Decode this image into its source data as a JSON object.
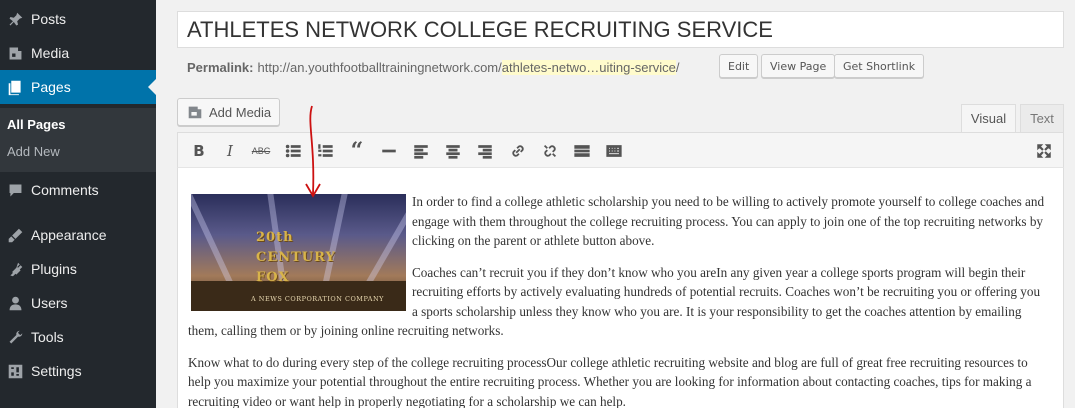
{
  "sidebar": {
    "items": [
      {
        "label": "Posts",
        "icon": "pin-icon"
      },
      {
        "label": "Media",
        "icon": "media-icon"
      },
      {
        "label": "Pages",
        "icon": "pages-icon"
      },
      {
        "label": "Comments",
        "icon": "comments-icon"
      },
      {
        "label": "Appearance",
        "icon": "appearance-icon"
      },
      {
        "label": "Plugins",
        "icon": "plugins-icon"
      },
      {
        "label": "Users",
        "icon": "users-icon"
      },
      {
        "label": "Tools",
        "icon": "tools-icon"
      },
      {
        "label": "Settings",
        "icon": "settings-icon"
      }
    ],
    "submenu": [
      "All Pages",
      "Add New"
    ]
  },
  "editor": {
    "title": "ATHLETES NETWORK COLLEGE RECRUITING SERVICE",
    "permalink_label": "Permalink:",
    "permalink_base": "http://an.youthfootballtrainingnetwork.com/",
    "permalink_slug": "athletes-netwo…uiting-service",
    "permalink_tail": "/",
    "edit_label": "Edit",
    "view_label": "View Page",
    "shortlink_label": "Get Shortlink",
    "add_media_label": "Add Media",
    "tab_visual": "Visual",
    "tab_text": "Text",
    "image_text": "20th CENTURY FOX",
    "image_subtext": "A NEWS CORPORATION COMPANY",
    "paragraphs": [
      "In order to find a college athletic scholarship you need to be willing to actively promote yourself to college coaches and engage with them throughout the college recruiting process. You can apply to join one of the top recruiting networks by clicking on the parent or athlete button above.",
      "Coaches can’t recruit you if they don’t know who you areIn any given year a college sports program will begin their recruiting efforts by actively evaluating hundreds of potential recruits. Coaches won’t be recruiting you or offering you a sports scholarship unless they know who you are. It is your responsibility to get the coaches attention by emailing them, calling them or by joining online recruiting networks.",
      "Know what to do during every step of the college recruiting processOur college athletic recruiting website and blog are full of great free recruiting resources to help you maximize your potential throughout the entire recruiting process. Whether you are looking for information about contacting coaches, tips for making a recruiting video or want help in properly negotiating for a scholarship we can help."
    ]
  },
  "colors": {
    "sidebar_bg": "#23282d",
    "accent": "#0073aa",
    "annotation_arrow": "#cc1111"
  }
}
